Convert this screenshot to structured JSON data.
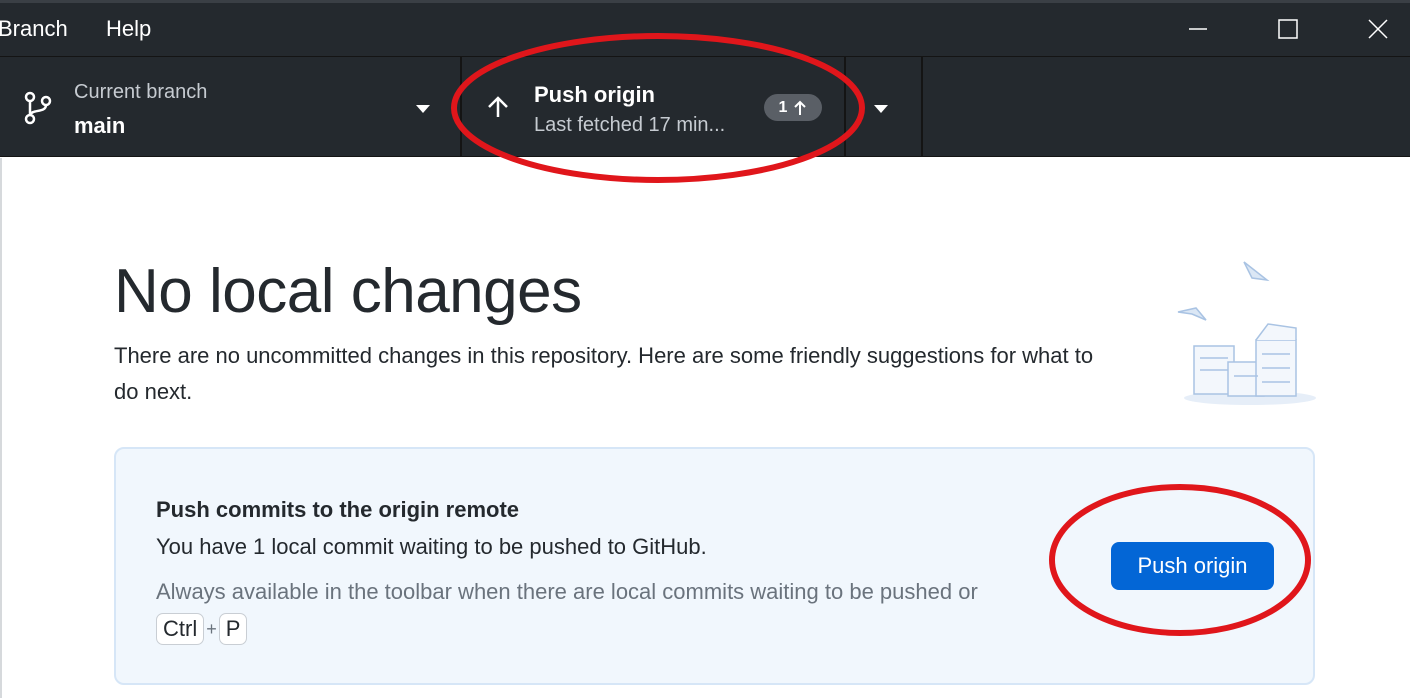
{
  "menu": {
    "items": [
      "Branch",
      "Help"
    ]
  },
  "window_controls": [
    "minimize-icon",
    "maximize-icon",
    "close-icon"
  ],
  "toolbar": {
    "branch": {
      "label": "Current branch",
      "value": "main",
      "icon": "git-branch-icon"
    },
    "push": {
      "label": "Push origin",
      "subtitle": "Last fetched 17 min...",
      "icon": "arrow-up-icon",
      "ahead_count": "1"
    }
  },
  "main": {
    "title": "No local changes",
    "description": "There are no uncommitted changes in this repository. Here are some friendly suggestions for what to do next.",
    "card": {
      "title": "Push commits to the origin remote",
      "description": "You have 1 local commit waiting to be pushed to GitHub.",
      "hint": "Always available in the toolbar when there are local commits waiting to be pushed or",
      "shortcut_keys": [
        "Ctrl",
        "P"
      ],
      "shortcut_sep": "+",
      "button_label": "Push origin"
    }
  },
  "colors": {
    "toolbar_bg": "#24292e",
    "button_blue": "#0366d6",
    "annotation_red": "#e0161b",
    "card_bg": "#f1f7fd"
  }
}
